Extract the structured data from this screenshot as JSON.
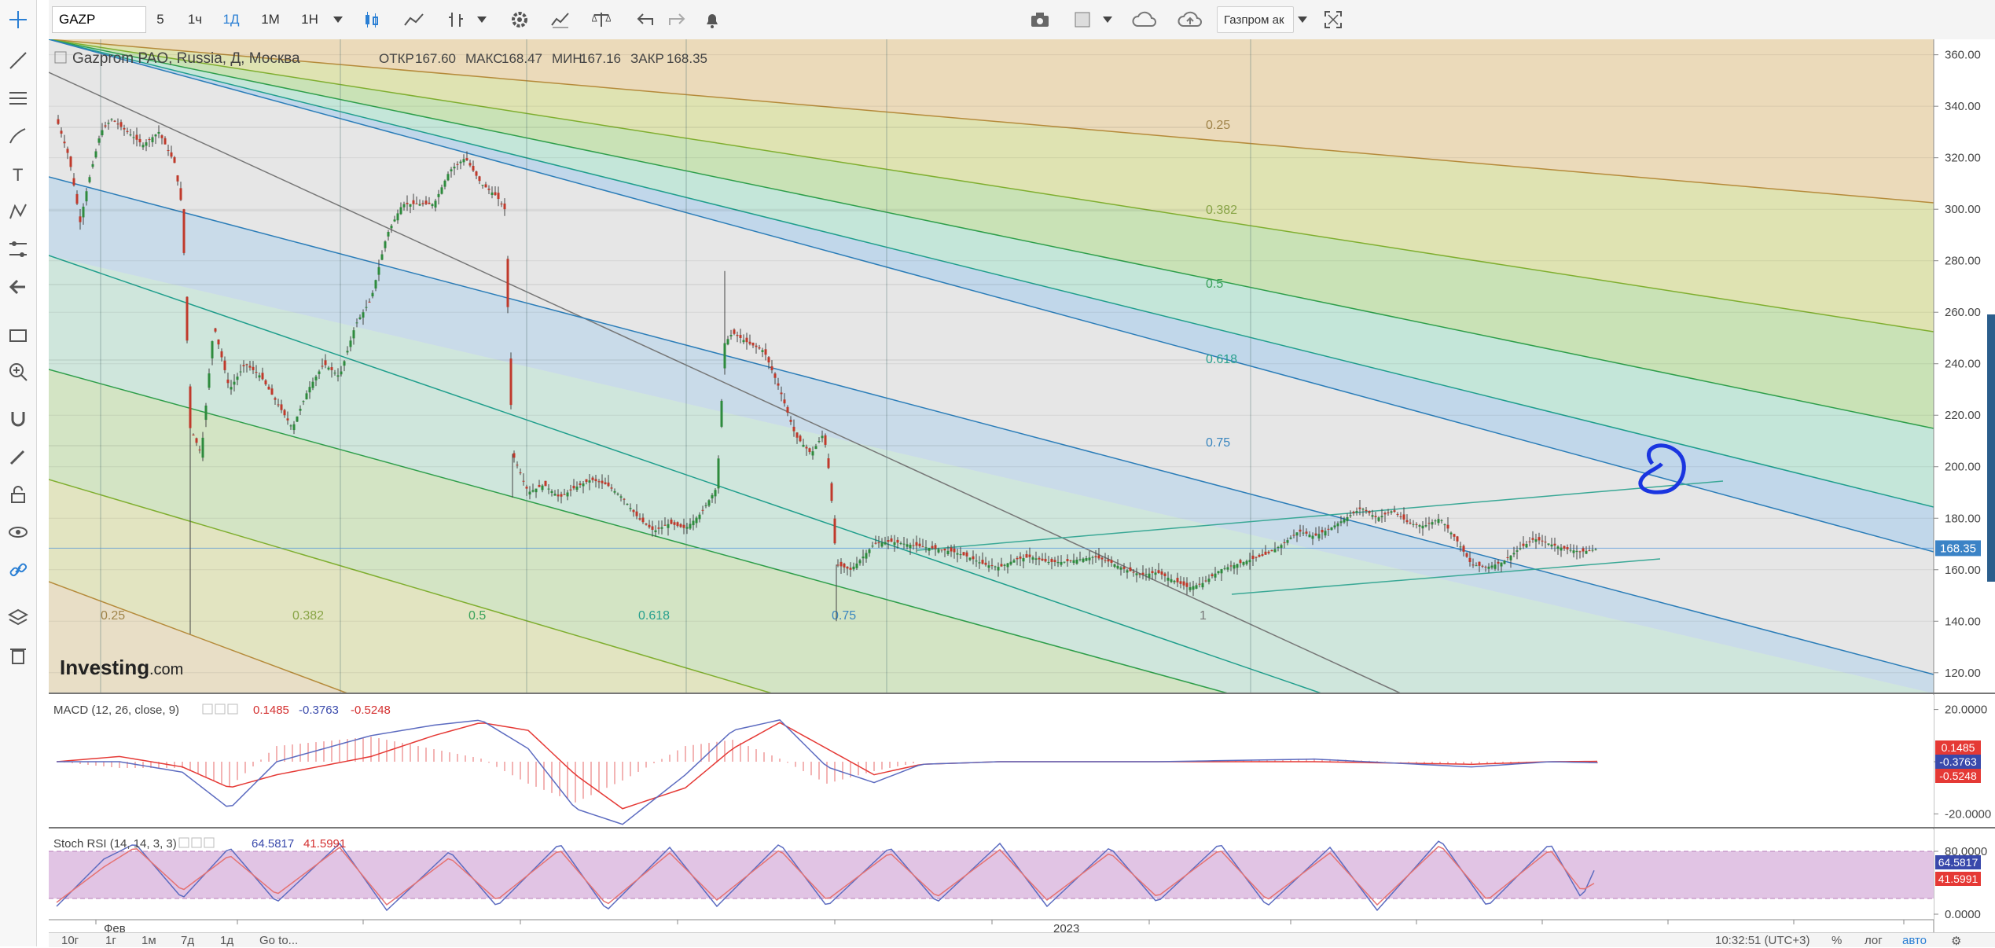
{
  "toolbar": {
    "symbol": "GAZP",
    "intervals": [
      "5",
      "1ч",
      "1Д",
      "1М",
      "1Н"
    ],
    "active_interval": "1Д",
    "right_label": "Газпром ак"
  },
  "chart_data": [
    {
      "type": "candlestick",
      "title": "Gazprom PAO, Russia, Д, Москва",
      "ohlc_labels": [
        "ОТКР",
        "МАКС",
        "МИН",
        "ЗАКР"
      ],
      "ohlc_values": [
        "167.60",
        "168.47",
        "167.16",
        "168.35"
      ],
      "last_price": "168.35",
      "yticks": [
        "360.00",
        "340.00",
        "320.00",
        "300.00",
        "280.00",
        "260.00",
        "240.00",
        "220.00",
        "200.00",
        "180.00",
        "160.00",
        "140.00",
        "120.00"
      ],
      "ylim": [
        112,
        366
      ],
      "xtick_labels": [
        "Фев",
        "2023"
      ],
      "fib_vertical_labels": [
        "0.25",
        "0.382",
        "0.5",
        "0.618",
        "0.75",
        "1"
      ],
      "fib_fan_labels": [
        "0.25",
        "0.382",
        "0.5",
        "0.618",
        "0.75"
      ],
      "close_path": [
        [
          0,
          335
        ],
        [
          8,
          320
        ],
        [
          15,
          295
        ],
        [
          20,
          310
        ],
        [
          28,
          330
        ],
        [
          35,
          335
        ],
        [
          45,
          330
        ],
        [
          55,
          325
        ],
        [
          65,
          330
        ],
        [
          75,
          318
        ],
        [
          80,
          300
        ],
        [
          85,
          215
        ],
        [
          92,
          205
        ],
        [
          100,
          255
        ],
        [
          110,
          230
        ],
        [
          120,
          240
        ],
        [
          130,
          235
        ],
        [
          140,
          225
        ],
        [
          150,
          215
        ],
        [
          160,
          230
        ],
        [
          170,
          240
        ],
        [
          180,
          235
        ],
        [
          190,
          255
        ],
        [
          200,
          265
        ],
        [
          210,
          290
        ],
        [
          220,
          302
        ],
        [
          230,
          302
        ],
        [
          240,
          302
        ],
        [
          250,
          315
        ],
        [
          260,
          320
        ],
        [
          270,
          310
        ],
        [
          280,
          305
        ],
        [
          285,
          300
        ],
        [
          290,
          205
        ],
        [
          300,
          190
        ],
        [
          310,
          193
        ],
        [
          320,
          188
        ],
        [
          330,
          192
        ],
        [
          340,
          195
        ],
        [
          350,
          193
        ],
        [
          360,
          188
        ],
        [
          370,
          180
        ],
        [
          380,
          175
        ],
        [
          390,
          178
        ],
        [
          400,
          176
        ],
        [
          410,
          182
        ],
        [
          420,
          192
        ],
        [
          425,
          248
        ],
        [
          430,
          252
        ],
        [
          440,
          248
        ],
        [
          450,
          245
        ],
        [
          460,
          230
        ],
        [
          470,
          212
        ],
        [
          480,
          205
        ],
        [
          488,
          213
        ],
        [
          492,
          195
        ],
        [
          496,
          162
        ],
        [
          505,
          160
        ],
        [
          510,
          163
        ],
        [
          520,
          170
        ],
        [
          530,
          171
        ],
        [
          540,
          170
        ],
        [
          550,
          169
        ],
        [
          560,
          168
        ],
        [
          570,
          167
        ],
        [
          580,
          165
        ],
        [
          590,
          162
        ],
        [
          600,
          161
        ],
        [
          610,
          164
        ],
        [
          620,
          165
        ],
        [
          630,
          163
        ],
        [
          640,
          163
        ],
        [
          650,
          164
        ],
        [
          660,
          165
        ],
        [
          670,
          163
        ],
        [
          680,
          160
        ],
        [
          690,
          158
        ],
        [
          700,
          159
        ],
        [
          710,
          156
        ],
        [
          720,
          153
        ],
        [
          730,
          155
        ],
        [
          740,
          160
        ],
        [
          750,
          162
        ],
        [
          760,
          164
        ],
        [
          770,
          166
        ],
        [
          780,
          170
        ],
        [
          790,
          175
        ],
        [
          800,
          173
        ],
        [
          810,
          176
        ],
        [
          820,
          180
        ],
        [
          830,
          184
        ],
        [
          840,
          180
        ],
        [
          850,
          183
        ],
        [
          860,
          178
        ],
        [
          870,
          177
        ],
        [
          880,
          180
        ],
        [
          890,
          172
        ],
        [
          900,
          162
        ],
        [
          910,
          161
        ],
        [
          920,
          163
        ],
        [
          930,
          168
        ],
        [
          940,
          172
        ],
        [
          950,
          170
        ],
        [
          960,
          168
        ],
        [
          970,
          167
        ],
        [
          980,
          168
        ]
      ]
    },
    {
      "type": "line",
      "title": "MACD (12, 26, close, 9)",
      "legend_values": [
        "0.1485",
        "-0.3763",
        "-0.5248"
      ],
      "yticks": [
        "20.0000",
        "0.0000",
        "-20.0000"
      ],
      "ylim": [
        -25,
        25
      ],
      "series": [
        {
          "color": "#e53935",
          "values": [
            [
              0,
              0
            ],
            [
              40,
              2
            ],
            [
              80,
              -2
            ],
            [
              110,
              -10
            ],
            [
              140,
              -5
            ],
            [
              200,
              2
            ],
            [
              240,
              10
            ],
            [
              270,
              15
            ],
            [
              300,
              12
            ],
            [
              330,
              -5
            ],
            [
              360,
              -18
            ],
            [
              400,
              -10
            ],
            [
              430,
              5
            ],
            [
              460,
              15
            ],
            [
              490,
              5
            ],
            [
              520,
              -5
            ],
            [
              550,
              -1
            ],
            [
              600,
              0
            ],
            [
              700,
              0
            ],
            [
              800,
              0
            ],
            [
              900,
              -1
            ],
            [
              950,
              0
            ],
            [
              980,
              0.15
            ]
          ]
        },
        {
          "color": "#5c6bc0",
          "values": [
            [
              0,
              0
            ],
            [
              40,
              0
            ],
            [
              80,
              -4
            ],
            [
              110,
              -18
            ],
            [
              140,
              0
            ],
            [
              200,
              10
            ],
            [
              240,
              14
            ],
            [
              270,
              16
            ],
            [
              300,
              5
            ],
            [
              330,
              -18
            ],
            [
              360,
              -24
            ],
            [
              400,
              -5
            ],
            [
              430,
              12
            ],
            [
              460,
              16
            ],
            [
              490,
              -2
            ],
            [
              520,
              -8
            ],
            [
              550,
              -1
            ],
            [
              600,
              0
            ],
            [
              700,
              0
            ],
            [
              800,
              1
            ],
            [
              900,
              -2
            ],
            [
              950,
              0
            ],
            [
              980,
              -0.38
            ]
          ]
        }
      ]
    },
    {
      "type": "line",
      "title": "Stoch RSI (14, 14, 3, 3)",
      "legend_values": [
        "64.5817",
        "41.5991"
      ],
      "yticks": [
        "80.0000",
        "0.0000"
      ],
      "ylim": [
        -5,
        105
      ],
      "series": [
        {
          "color": "#5c6bc0",
          "values": [
            [
              0,
              10
            ],
            [
              30,
              70
            ],
            [
              50,
              90
            ],
            [
              80,
              20
            ],
            [
              110,
              85
            ],
            [
              140,
              15
            ],
            [
              180,
              90
            ],
            [
              210,
              5
            ],
            [
              250,
              80
            ],
            [
              280,
              10
            ],
            [
              320,
              90
            ],
            [
              350,
              5
            ],
            [
              390,
              85
            ],
            [
              420,
              10
            ],
            [
              460,
              90
            ],
            [
              490,
              10
            ],
            [
              530,
              85
            ],
            [
              560,
              15
            ],
            [
              600,
              90
            ],
            [
              630,
              10
            ],
            [
              670,
              85
            ],
            [
              700,
              15
            ],
            [
              740,
              90
            ],
            [
              770,
              10
            ],
            [
              810,
              85
            ],
            [
              840,
              5
            ],
            [
              880,
              95
            ],
            [
              910,
              10
            ],
            [
              950,
              90
            ],
            [
              970,
              20
            ],
            [
              980,
              64.6
            ]
          ]
        },
        {
          "color": "#e57373",
          "values": [
            [
              0,
              15
            ],
            [
              30,
              60
            ],
            [
              50,
              85
            ],
            [
              80,
              30
            ],
            [
              110,
              75
            ],
            [
              140,
              25
            ],
            [
              180,
              85
            ],
            [
              210,
              12
            ],
            [
              250,
              72
            ],
            [
              280,
              18
            ],
            [
              320,
              82
            ],
            [
              350,
              12
            ],
            [
              390,
              78
            ],
            [
              420,
              18
            ],
            [
              460,
              82
            ],
            [
              490,
              18
            ],
            [
              530,
              78
            ],
            [
              560,
              22
            ],
            [
              600,
              82
            ],
            [
              630,
              18
            ],
            [
              670,
              78
            ],
            [
              700,
              22
            ],
            [
              740,
              82
            ],
            [
              770,
              18
            ],
            [
              810,
              78
            ],
            [
              840,
              12
            ],
            [
              880,
              88
            ],
            [
              910,
              18
            ],
            [
              950,
              82
            ],
            [
              970,
              30
            ],
            [
              980,
              41.6
            ]
          ]
        }
      ]
    }
  ],
  "watermark": {
    "brand": "Investing",
    "suffix": ".com"
  },
  "bottom_bar": {
    "ranges": [
      "10г",
      "1г",
      "1м",
      "7д",
      "1д",
      "Go to..."
    ],
    "time": "10:32:51 (UTC+3)",
    "percent": "%",
    "log": "лог",
    "auto": "авто"
  }
}
